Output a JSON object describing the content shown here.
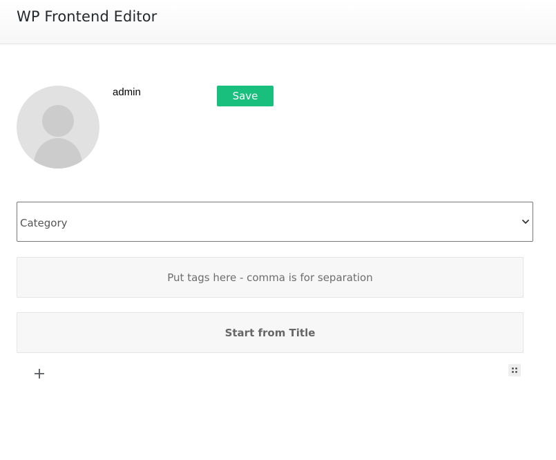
{
  "header": {
    "title": "WP Frontend Editor"
  },
  "author": {
    "username": "admin",
    "avatar_icon": "user-avatar-placeholder"
  },
  "toolbar": {
    "save_label": "Save"
  },
  "category": {
    "selected": "Category",
    "icon": "chevron-down-icon"
  },
  "tags": {
    "placeholder": "Put tags here - comma is for separation"
  },
  "editor": {
    "title_placeholder": "Start from Title",
    "add_block_icon": "plus-icon",
    "drag_handle_icon": "drag-handle-icon"
  },
  "colors": {
    "save_button": "#19bf7c",
    "avatar_bg": "#e1e1e1",
    "avatar_figure": "#cccccc",
    "field_bg": "#f7f7f7"
  }
}
